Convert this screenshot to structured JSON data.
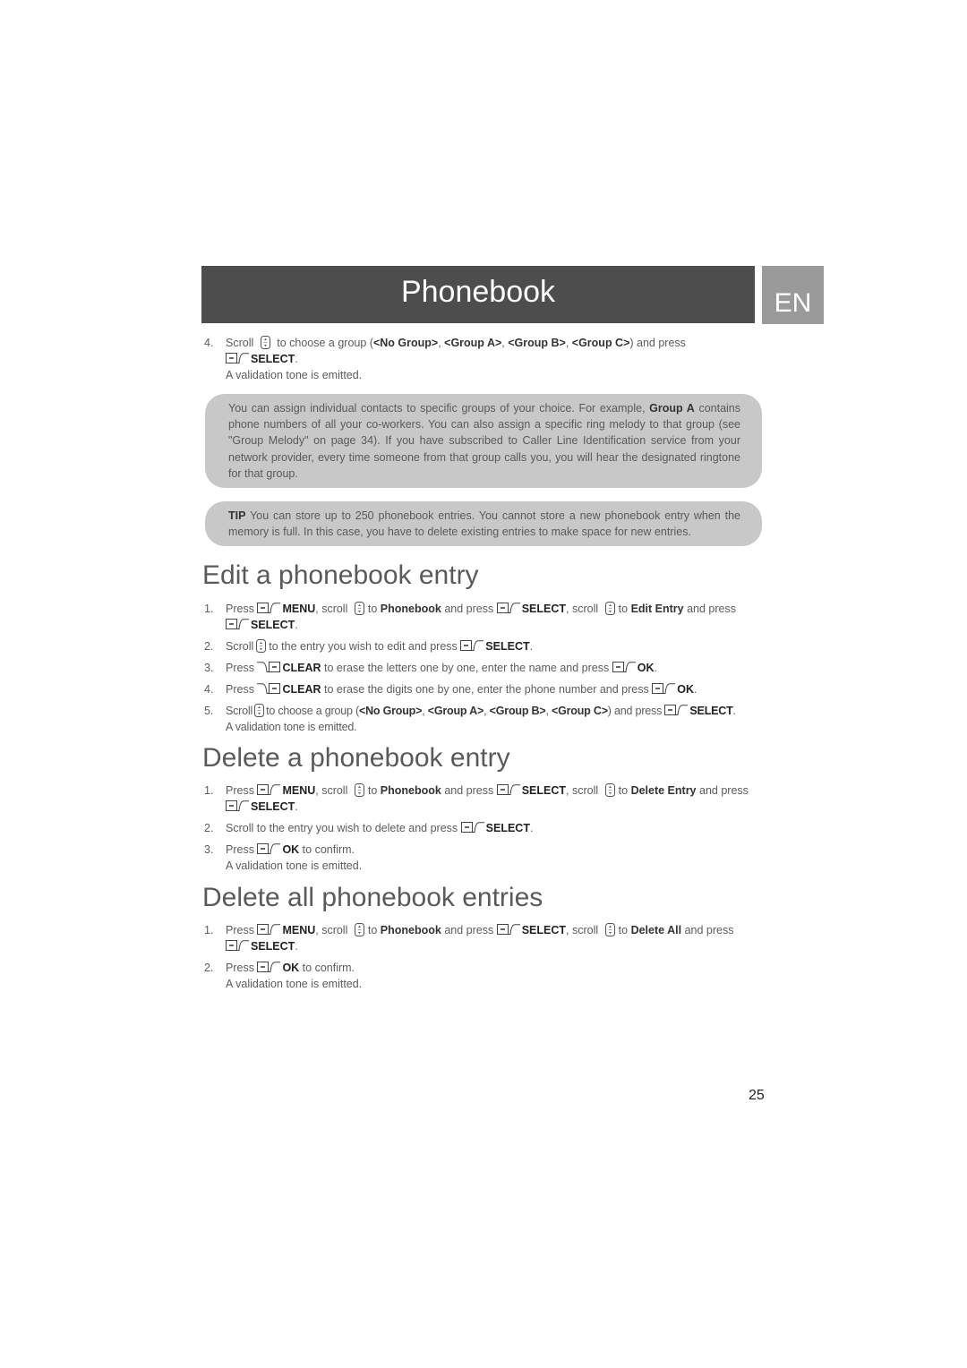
{
  "header": {
    "title": "Phonebook",
    "language_tab": "EN"
  },
  "icons": {
    "softkey_left": "left-softkey-icon",
    "softkey_right": "right-softkey-icon",
    "scroll": "scroll-key-icon"
  },
  "top_steps": [
    {
      "num": "4.",
      "parts": [
        "Scroll",
        "to choose a group (",
        "<No Group>",
        ", ",
        "<Group A>",
        ", ",
        "<Group B>",
        ", ",
        "<Group C>",
        ") and press",
        "SELECT",
        "."
      ],
      "result": "A validation tone is emitted."
    }
  ],
  "note_groups": {
    "text_before": "You can assign individual contacts to specific groups of your choice. For example, ",
    "bold": "Group A",
    "text_after": " contains phone numbers of all your co-workers. You can also assign a specific ring melody to that group (see \"Group Melody\" on page 34). If you have subscribed to Caller Line Identification service from your network provider, every time someone from that group calls you, you will hear the designated ringtone for that group."
  },
  "tip": {
    "label": "TIP",
    "text": " You can store up to 250 phonebook entries. You cannot store a new phonebook entry when the memory is full. In this case, you have to delete existing entries to make space for new entries."
  },
  "sections": [
    {
      "title": "Edit a phonebook entry",
      "steps": [
        {
          "num": "1.",
          "text": [
            "Press",
            "MENU",
            ", scroll",
            "to",
            "Phonebook",
            "and press",
            "SELECT",
            ", scroll",
            "to",
            "Edit Entry",
            "and press",
            "SELECT",
            "."
          ]
        },
        {
          "num": "2.",
          "text": [
            "Scroll",
            "to the entry you wish to edit and press",
            "SELECT",
            "."
          ]
        },
        {
          "num": "3.",
          "text": [
            "Press",
            "CLEAR",
            "to erase the letters one by one, enter the name and press",
            "OK",
            "."
          ]
        },
        {
          "num": "4.",
          "text": [
            "Press",
            "CLEAR",
            "to erase the digits one by one, enter the phone number and press",
            "OK",
            "."
          ]
        },
        {
          "num": "5.",
          "text": [
            "Scroll",
            "to choose a group (",
            "<No Group>",
            ", ",
            "<Group A>",
            ", ",
            "<Group B>",
            ", ",
            "<Group C>",
            ") and press",
            "SELECT",
            "."
          ],
          "result": "A validation tone is emitted."
        }
      ]
    },
    {
      "title": "Delete a phonebook entry",
      "steps": [
        {
          "num": "1.",
          "text": [
            "Press",
            "MENU",
            ", scroll",
            "to",
            "Phonebook",
            "and press",
            "SELECT",
            ", scroll",
            "to",
            "Delete Entry",
            "and press",
            "SELECT",
            "."
          ]
        },
        {
          "num": "2.",
          "text": [
            "Scroll to the entry you wish to delete and press",
            "SELECT",
            "."
          ]
        },
        {
          "num": "3.",
          "text": [
            "Press",
            "OK",
            "to confirm."
          ],
          "result": "A validation tone is emitted."
        }
      ]
    },
    {
      "title": "Delete all phonebook entries",
      "steps": [
        {
          "num": "1.",
          "text": [
            "Press",
            "MENU",
            ", scroll",
            "to",
            "Phonebook",
            "and press",
            "SELECT",
            ", scroll",
            "to",
            "Delete All",
            "and press",
            "SELECT",
            "."
          ]
        },
        {
          "num": "2.",
          "text": [
            "Press",
            "OK",
            "to confirm."
          ],
          "result": "A validation tone is emitted."
        }
      ]
    }
  ],
  "page_number": "25"
}
